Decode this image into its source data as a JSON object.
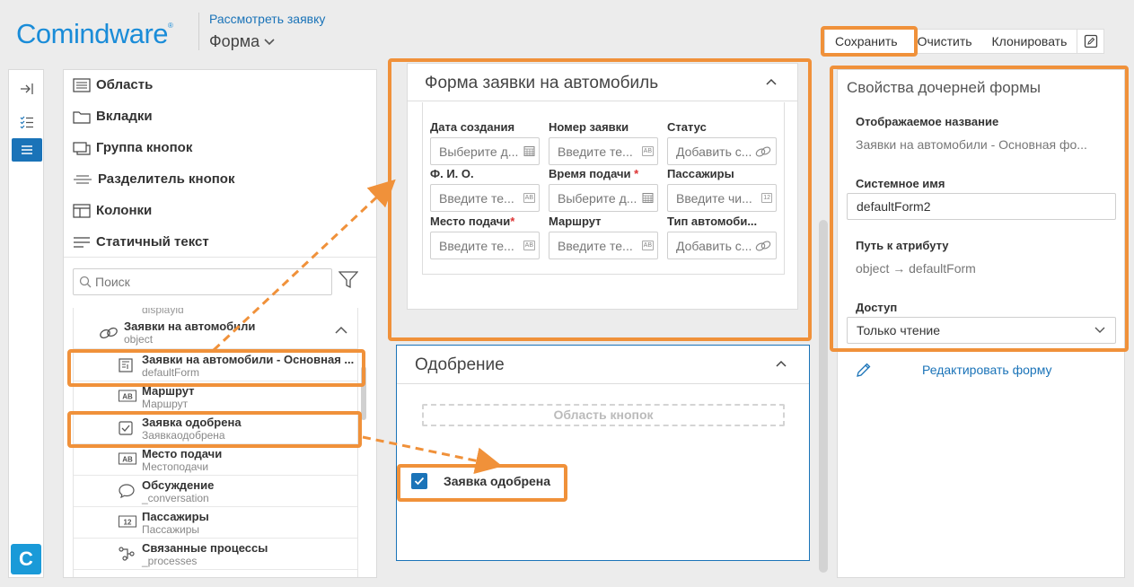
{
  "header": {
    "logo_text": "Comindware",
    "logo_reg": "®",
    "breadcrumb": "Рассмотреть заявку",
    "form_selector": "Форма"
  },
  "toolbar": {
    "save_label": "Сохранить",
    "clear_label": "Очистить",
    "clone_label": "Клонировать",
    "edit_icon": "edit-icon"
  },
  "palette": {
    "items": [
      {
        "label": "Область",
        "icon": "list-icon"
      },
      {
        "label": "Вкладки",
        "icon": "folder-icon"
      },
      {
        "label": "Группа кнопок",
        "icon": "button-group-icon"
      },
      {
        "label": "Разделитель кнопок",
        "icon": "divider-icon"
      },
      {
        "label": "Колонки",
        "icon": "columns-icon"
      },
      {
        "label": "Статичный текст",
        "icon": "text-icon"
      }
    ],
    "search_placeholder": "Поиск",
    "tree": {
      "cut_row": "displayid",
      "parent": {
        "title": "Заявки на автомобили",
        "sub": "object"
      },
      "rows": [
        {
          "title": "Заявки на автомобили - Основная ...",
          "sub": "defaultForm",
          "icon": "form-icon"
        },
        {
          "title": "Маршрут",
          "sub": "Маршрут",
          "icon": "text-field-icon"
        },
        {
          "title": "Заявка одобрена",
          "sub": "Заявкаодобрена",
          "icon": "checkbox-icon"
        },
        {
          "title": "Место подачи",
          "sub": "Местоподачи",
          "icon": "text-field-icon"
        },
        {
          "title": "Обсуждение",
          "sub": "_conversation",
          "icon": "chat-icon"
        },
        {
          "title": "Пассажиры",
          "sub": "Пассажиры",
          "icon": "number-field-icon"
        },
        {
          "title": "Связанные процессы",
          "sub": "_processes",
          "icon": "process-icon"
        }
      ]
    }
  },
  "form_card": {
    "title": "Форма заявки на автомобиль",
    "fields": [
      {
        "label": "Дата создания",
        "required": false,
        "placeholder": "Выберите д...",
        "icon": "calendar-icon"
      },
      {
        "label": "Номер заявки",
        "required": false,
        "placeholder": "Введите те...",
        "icon": "ab-icon"
      },
      {
        "label": "Статус",
        "required": false,
        "placeholder": "Добавить с...",
        "icon": "link-icon"
      },
      {
        "label": "Ф. И. О.",
        "required": false,
        "placeholder": "Введите те...",
        "icon": "ab-icon"
      },
      {
        "label": "Время подачи",
        "required": true,
        "placeholder": "Выберите д...",
        "icon": "calendar-icon"
      },
      {
        "label": "Пассажиры",
        "required": false,
        "placeholder": "Введите чи...",
        "icon": "number-icon"
      },
      {
        "label": "Место подачи",
        "required": true,
        "placeholder": "Введите те...",
        "icon": "ab-icon"
      },
      {
        "label": "Маршрут",
        "required": false,
        "placeholder": "Введите те...",
        "icon": "ab-icon"
      },
      {
        "label": "Тип автомоби...",
        "required": false,
        "placeholder": "Добавить с...",
        "icon": "link-icon"
      }
    ],
    "ab_badge": "AB",
    "num_badge": "12",
    "required_mark": "*"
  },
  "approval_card": {
    "title": "Одобрение",
    "button_area": "Область кнопок",
    "checkbox_label": "Заявка одобрена",
    "checked": true
  },
  "properties": {
    "title": "Свойства дочерней формы",
    "display_name_label": "Отображаемое название",
    "display_name_value": "Заявки на автомобили - Основная фо...",
    "system_name_label": "Системное имя",
    "system_name_value": "defaultForm2",
    "attr_path_label": "Путь к атрибуту",
    "attr_path_value": "object → defaultForm",
    "access_label": "Доступ",
    "access_value": "Только чтение",
    "edit_form_link": "Редактировать форму"
  },
  "colors": {
    "accent": "#1a73b8",
    "highlight": "#f0913a",
    "brand": "#1a8cd8"
  }
}
